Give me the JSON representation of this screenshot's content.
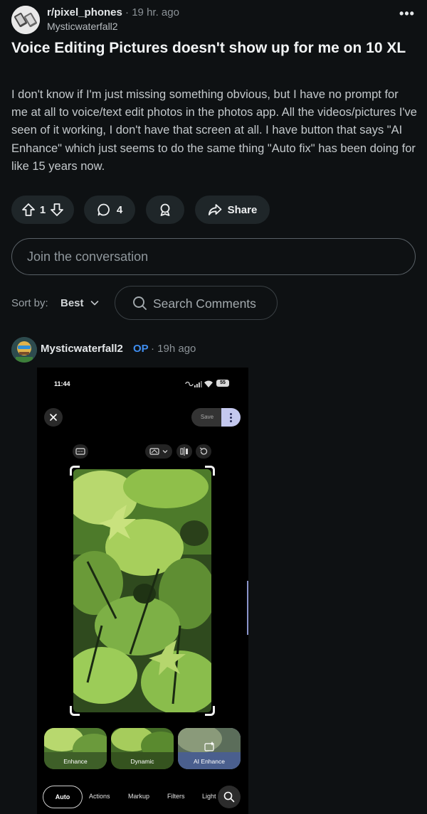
{
  "post": {
    "subreddit": "r/pixel_phones",
    "separator": "·",
    "time": "19 hr. ago",
    "author": "Mysticwaterfall2",
    "more_icon": "more-horizontal-icon",
    "more_label": "•••",
    "title": "Voice Editing Pictures doesn't show up for me on 10 XL",
    "body": "I don't know if I'm just missing something obvious, but I have no prompt for me at all to voice/text edit photos in the photos app. All the videos/pictures I've seen of it working, I don't have that screen at all. I have button that says \"AI Enhance\" which just seems to do the same thing \"Auto fix\" has been doing for like 15 years now."
  },
  "actions": {
    "vote_count": "1",
    "comment_count": "4",
    "share_label": "Share"
  },
  "join": {
    "placeholder": "Join the conversation"
  },
  "sort": {
    "label": "Sort by:",
    "value": "Best",
    "search_placeholder": "Search Comments"
  },
  "comment": {
    "author": "Mysticwaterfall2",
    "badge": "OP",
    "time": "· 19h ago"
  },
  "screenshot": {
    "status_time": "11:44",
    "battery": "55",
    "save_label": "Save",
    "filters": [
      {
        "label": "Enhance",
        "selected": false
      },
      {
        "label": "Dynamic",
        "selected": false
      },
      {
        "label": "AI Enhance",
        "selected": true
      }
    ],
    "nav": {
      "auto": "Auto",
      "actions": "Actions",
      "markup": "Markup",
      "filters": "Filters",
      "light": "Light"
    }
  },
  "colors": {
    "background": "#0e1113",
    "pill": "#1f2629",
    "op_badge": "#3f8ef0",
    "selected_filter": "#a6b2f0"
  }
}
